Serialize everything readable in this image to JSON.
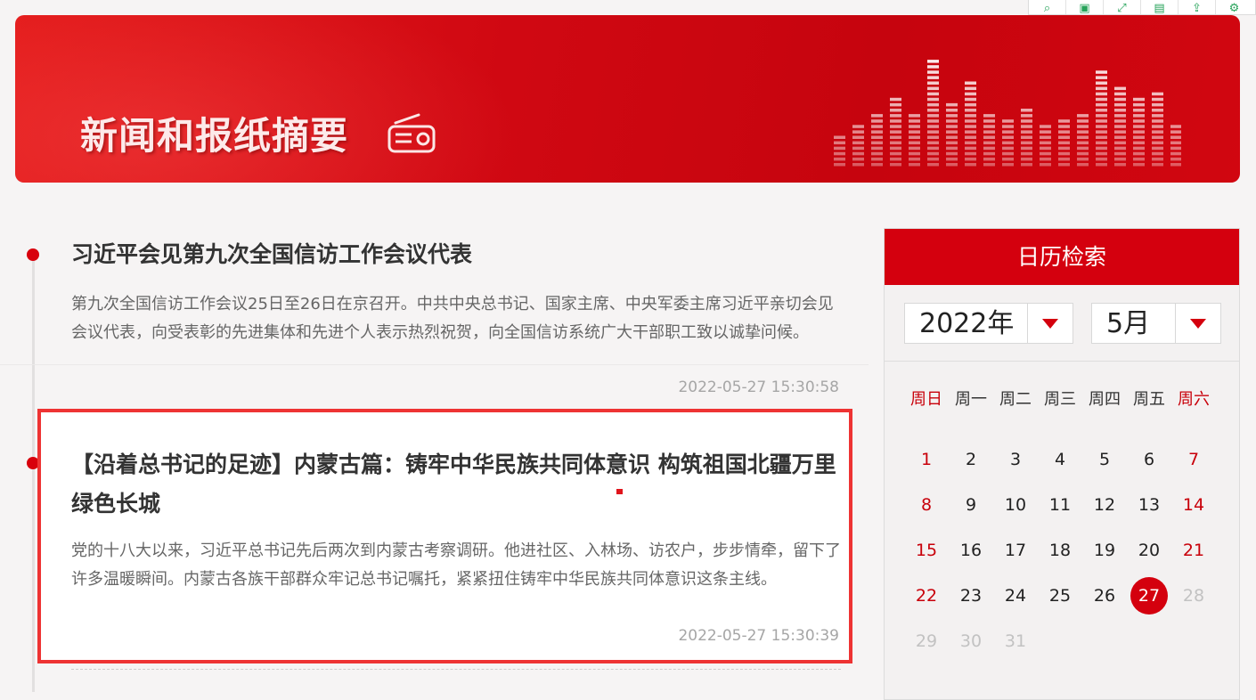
{
  "toolbar": {
    "icons": [
      "search-icon",
      "copy-icon",
      "expand-icon",
      "save-icon",
      "share-icon",
      "gear-icon"
    ],
    "glyphs": [
      "⌕",
      "▣",
      "⤢",
      "▤",
      "⇪",
      "⚙"
    ],
    "color": "#27a35a"
  },
  "banner": {
    "title": "新闻和报纸摘要",
    "icon": "radio-icon",
    "color": "#d00812"
  },
  "articles": [
    {
      "title": "习近平会见第九次全国信访工作会议代表",
      "summary": "第九次全国信访工作会议25日至26日在京召开。中共中央总书记、国家主席、中央军委主席习近平亲切会见会议代表，向受表彰的先进集体和先进个人表示热烈祝贺，向全国信访系统广大干部职工致以诚挚问候。",
      "time": "2022-05-27 15:30:58"
    },
    {
      "title": "【沿着总书记的足迹】内蒙古篇：铸牢中华民族共同体意识 构筑祖国北疆万里绿色长城",
      "summary": "党的十八大以来，习近平总书记先后两次到内蒙古考察调研。他进社区、入林场、访农户，步步情牵，留下了许多温暖瞬间。内蒙古各族干部群众牢记总书记嘱托，紧紧扭住铸牢中华民族共同体意识这条主线。",
      "time": "2022-05-27 15:30:39"
    }
  ],
  "calendar": {
    "title": "日历检索",
    "year": "2022年",
    "month": "5月",
    "weekdays": [
      "周日",
      "周一",
      "周二",
      "周三",
      "周四",
      "周五",
      "周六"
    ],
    "days": [
      "1",
      "2",
      "3",
      "4",
      "5",
      "6",
      "7",
      "8",
      "9",
      "10",
      "11",
      "12",
      "13",
      "14",
      "15",
      "16",
      "17",
      "18",
      "19",
      "20",
      "21",
      "22",
      "23",
      "24",
      "25",
      "26",
      "27",
      "28",
      "29",
      "30",
      "31"
    ],
    "today": 27,
    "last_enabled": 27,
    "accent": "#d4000e",
    "weekend_color": "#c8000a"
  }
}
